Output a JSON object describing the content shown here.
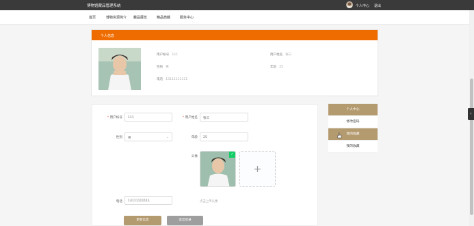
{
  "topbar": {
    "title": "博物馆藏品管理系统",
    "user_label": "个人中心",
    "logout_label": "退出"
  },
  "nav": [
    "首页",
    "博物资源简介",
    "藏品展览",
    "精品典藏",
    "服务中心"
  ],
  "info_panel": {
    "heading": "个人信息",
    "fields": [
      {
        "label": "用户帐号",
        "value": "111"
      },
      {
        "label": "用户姓名",
        "value": "张三"
      },
      {
        "label": "性别",
        "value": "男"
      },
      {
        "label": "年龄",
        "value": "25"
      },
      {
        "label": "电话",
        "value": "13111111111"
      }
    ]
  },
  "form": {
    "account_label": "用户帐号",
    "account_value": "111",
    "name_label": "用户姓名",
    "name_value": "张三",
    "gender_label": "性别",
    "gender_value": "男",
    "age_label": "年龄",
    "age_value": "25",
    "avatar_label": "头像",
    "upload_plus": "+",
    "phone_label": "电话",
    "phone_value": "13111111111",
    "upload_hint": "点击上传头像",
    "update_button": "更新信息",
    "logout_button": "退出登录",
    "required_mark": "*"
  },
  "side_menu": [
    "个人中心",
    "修改密码",
    "我的收藏",
    "我的收藏"
  ],
  "colors": {
    "accent": "#ef6c00",
    "tan": "#b49a6f",
    "gray_btn": "#9e9e9e"
  }
}
